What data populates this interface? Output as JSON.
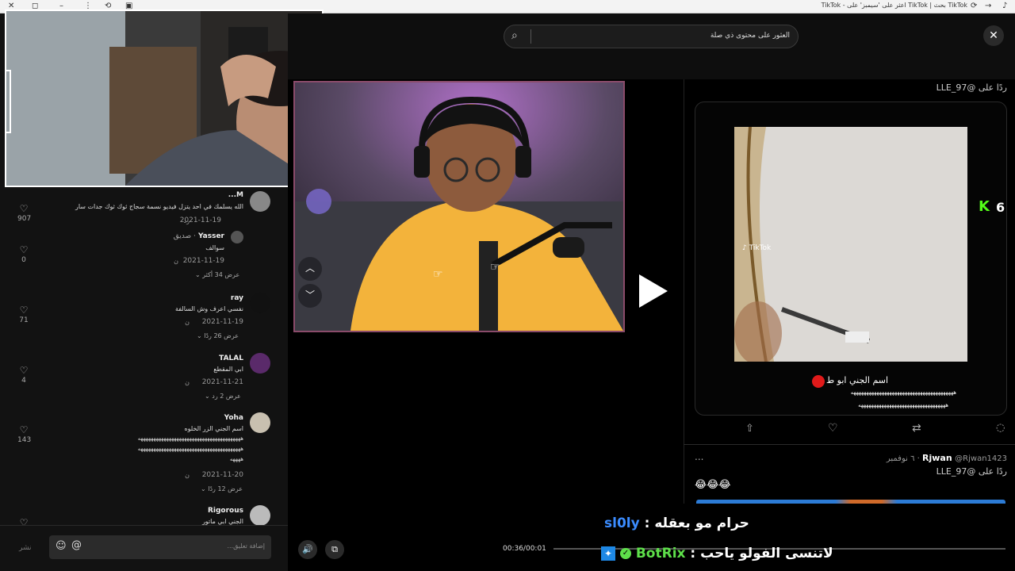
{
  "browser": {
    "title": "TikTok بحث | TikTok اعثر على 'سيمبز' على - TikTok"
  },
  "comments": [
    {
      "name": "M...",
      "text": "الله يسلمك في احد يتزل فيديو نسمة سجاج ثوك ثوك جدات سار",
      "date": "2021-11-19",
      "likes": "907",
      "reply_label": "رد",
      "replies": ""
    },
    {
      "name": "Yasser",
      "badge": "· صديق",
      "text": "سوالف",
      "date": "2021-11-19",
      "likes": "0",
      "reply_label": "ن",
      "replies": "عرض 34 أكثر"
    },
    {
      "name": "ray",
      "text": "نفسي اعرف وش السالفة",
      "date": "2021-11-19",
      "likes": "71",
      "reply_label": "ن",
      "replies": "عرض 26 ردًا"
    },
    {
      "name": "TALAL",
      "text": "ابي المقطع",
      "date": "2021-11-21",
      "likes": "4",
      "reply_label": "ن",
      "replies": "عرض 2 رد"
    },
    {
      "name": "Yoha",
      "text": "اسم الجني الزر الخلوه",
      "text2": "ههههههههههههههههههههههههههههههههههههههههه",
      "text3": "ههههههههههههههههههههههههههههههههههههههههه",
      "text4": "ههههه",
      "date": "2021-11-20",
      "likes": "143",
      "reply_label": "ن",
      "replies": "عرض 12 ردًا"
    },
    {
      "name": "Rigorous",
      "text": "الجني ابي ماتور",
      "date": "",
      "likes": "",
      "reply_label": "",
      "replies": ""
    }
  ],
  "comment_input": {
    "placeholder": "إضافة تعليق...",
    "post_label": "نشر"
  },
  "search": {
    "placeholder": "العثور على محتوى ذي صلة"
  },
  "player": {
    "time": "00:36/00:01"
  },
  "tweet": {
    "reply_to_top": "ردًا على @LLE_97",
    "caption1": "اسم الجني ابو ط",
    "caption2": "ههههههههههههههههههههههههههههههههههههههههه",
    "caption3": "ههههههههههههههههههههههههههههههههههه",
    "reply_author": "Rjwan",
    "reply_handle": "@Rjwan1423 · ٦ نوفمبر",
    "reply_to": "ردًا على @LLE_97",
    "reply_emojis": "😂😂😂",
    "side_count": "6",
    "more": "..."
  },
  "chat": [
    {
      "user": "sl0ly",
      "sep": " : ",
      "message": "حرام مو بعقله",
      "color": "#3b8cff"
    },
    {
      "user": "BotRix",
      "sep": " : ",
      "message": "لاتنسى الفولو ياحب",
      "color": "#5ee04a"
    }
  ],
  "colors": {
    "accent_kick": "#53fc18",
    "hoodie": "#f3b33b"
  }
}
